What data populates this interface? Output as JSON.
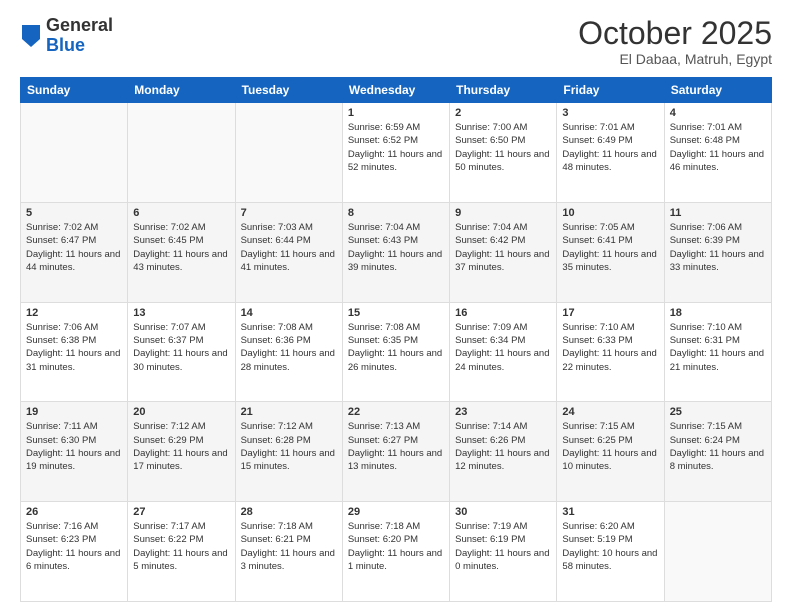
{
  "header": {
    "logo_general": "General",
    "logo_blue": "Blue",
    "month": "October 2025",
    "location": "El Dabaa, Matruh, Egypt"
  },
  "days_of_week": [
    "Sunday",
    "Monday",
    "Tuesday",
    "Wednesday",
    "Thursday",
    "Friday",
    "Saturday"
  ],
  "weeks": [
    [
      {
        "day": "",
        "info": ""
      },
      {
        "day": "",
        "info": ""
      },
      {
        "day": "",
        "info": ""
      },
      {
        "day": "1",
        "info": "Sunrise: 6:59 AM\nSunset: 6:52 PM\nDaylight: 11 hours\nand 52 minutes."
      },
      {
        "day": "2",
        "info": "Sunrise: 7:00 AM\nSunset: 6:50 PM\nDaylight: 11 hours\nand 50 minutes."
      },
      {
        "day": "3",
        "info": "Sunrise: 7:01 AM\nSunset: 6:49 PM\nDaylight: 11 hours\nand 48 minutes."
      },
      {
        "day": "4",
        "info": "Sunrise: 7:01 AM\nSunset: 6:48 PM\nDaylight: 11 hours\nand 46 minutes."
      }
    ],
    [
      {
        "day": "5",
        "info": "Sunrise: 7:02 AM\nSunset: 6:47 PM\nDaylight: 11 hours\nand 44 minutes."
      },
      {
        "day": "6",
        "info": "Sunrise: 7:02 AM\nSunset: 6:45 PM\nDaylight: 11 hours\nand 43 minutes."
      },
      {
        "day": "7",
        "info": "Sunrise: 7:03 AM\nSunset: 6:44 PM\nDaylight: 11 hours\nand 41 minutes."
      },
      {
        "day": "8",
        "info": "Sunrise: 7:04 AM\nSunset: 6:43 PM\nDaylight: 11 hours\nand 39 minutes."
      },
      {
        "day": "9",
        "info": "Sunrise: 7:04 AM\nSunset: 6:42 PM\nDaylight: 11 hours\nand 37 minutes."
      },
      {
        "day": "10",
        "info": "Sunrise: 7:05 AM\nSunset: 6:41 PM\nDaylight: 11 hours\nand 35 minutes."
      },
      {
        "day": "11",
        "info": "Sunrise: 7:06 AM\nSunset: 6:39 PM\nDaylight: 11 hours\nand 33 minutes."
      }
    ],
    [
      {
        "day": "12",
        "info": "Sunrise: 7:06 AM\nSunset: 6:38 PM\nDaylight: 11 hours\nand 31 minutes."
      },
      {
        "day": "13",
        "info": "Sunrise: 7:07 AM\nSunset: 6:37 PM\nDaylight: 11 hours\nand 30 minutes."
      },
      {
        "day": "14",
        "info": "Sunrise: 7:08 AM\nSunset: 6:36 PM\nDaylight: 11 hours\nand 28 minutes."
      },
      {
        "day": "15",
        "info": "Sunrise: 7:08 AM\nSunset: 6:35 PM\nDaylight: 11 hours\nand 26 minutes."
      },
      {
        "day": "16",
        "info": "Sunrise: 7:09 AM\nSunset: 6:34 PM\nDaylight: 11 hours\nand 24 minutes."
      },
      {
        "day": "17",
        "info": "Sunrise: 7:10 AM\nSunset: 6:33 PM\nDaylight: 11 hours\nand 22 minutes."
      },
      {
        "day": "18",
        "info": "Sunrise: 7:10 AM\nSunset: 6:31 PM\nDaylight: 11 hours\nand 21 minutes."
      }
    ],
    [
      {
        "day": "19",
        "info": "Sunrise: 7:11 AM\nSunset: 6:30 PM\nDaylight: 11 hours\nand 19 minutes."
      },
      {
        "day": "20",
        "info": "Sunrise: 7:12 AM\nSunset: 6:29 PM\nDaylight: 11 hours\nand 17 minutes."
      },
      {
        "day": "21",
        "info": "Sunrise: 7:12 AM\nSunset: 6:28 PM\nDaylight: 11 hours\nand 15 minutes."
      },
      {
        "day": "22",
        "info": "Sunrise: 7:13 AM\nSunset: 6:27 PM\nDaylight: 11 hours\nand 13 minutes."
      },
      {
        "day": "23",
        "info": "Sunrise: 7:14 AM\nSunset: 6:26 PM\nDaylight: 11 hours\nand 12 minutes."
      },
      {
        "day": "24",
        "info": "Sunrise: 7:15 AM\nSunset: 6:25 PM\nDaylight: 11 hours\nand 10 minutes."
      },
      {
        "day": "25",
        "info": "Sunrise: 7:15 AM\nSunset: 6:24 PM\nDaylight: 11 hours\nand 8 minutes."
      }
    ],
    [
      {
        "day": "26",
        "info": "Sunrise: 7:16 AM\nSunset: 6:23 PM\nDaylight: 11 hours\nand 6 minutes."
      },
      {
        "day": "27",
        "info": "Sunrise: 7:17 AM\nSunset: 6:22 PM\nDaylight: 11 hours\nand 5 minutes."
      },
      {
        "day": "28",
        "info": "Sunrise: 7:18 AM\nSunset: 6:21 PM\nDaylight: 11 hours\nand 3 minutes."
      },
      {
        "day": "29",
        "info": "Sunrise: 7:18 AM\nSunset: 6:20 PM\nDaylight: 11 hours\nand 1 minute."
      },
      {
        "day": "30",
        "info": "Sunrise: 7:19 AM\nSunset: 6:19 PM\nDaylight: 11 hours\nand 0 minutes."
      },
      {
        "day": "31",
        "info": "Sunrise: 6:20 AM\nSunset: 5:19 PM\nDaylight: 10 hours\nand 58 minutes."
      },
      {
        "day": "",
        "info": ""
      }
    ]
  ]
}
